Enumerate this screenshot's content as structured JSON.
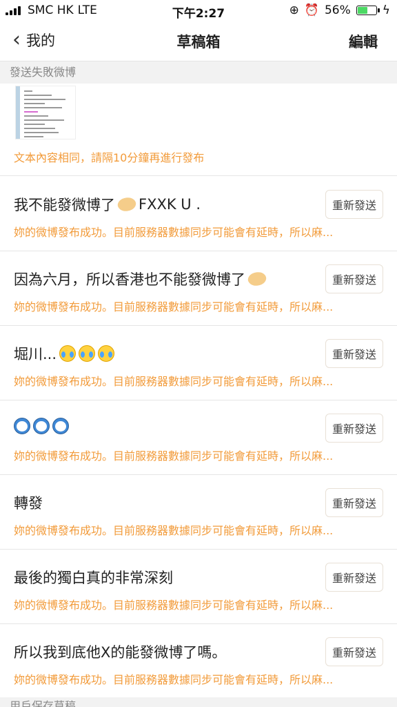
{
  "status_bar": {
    "carrier": "SMC HK",
    "network": "LTE",
    "time": "下午2:27",
    "battery": "56%",
    "battery_level": 0.56
  },
  "nav": {
    "back_label": "我的",
    "title": "草稿箱",
    "edit_label": "編輯"
  },
  "section_failed": "發送失敗微博",
  "first_item": {
    "error": "文本內容相同，請隔10分鐘再進行發布"
  },
  "resend_label": "重新發送",
  "items": [
    {
      "text": "我不能發微博了",
      "suffix": "FXXK U .",
      "emoji": "hands-icon",
      "status": "妳的微博發布成功。目前服務器數據同步可能會有延時，所以麻..."
    },
    {
      "text": "因為六月，所以香港也不能發微博了",
      "suffix": "",
      "emoji": "hands-icon",
      "status": "妳的微博發布成功。目前服務器數據同步可能會有延時，所以麻..."
    },
    {
      "text": "堀川...",
      "suffix": "",
      "emoji": "crying-face-icon",
      "status": "妳的微博發布成功。目前服務器數據同步可能會有延時，所以麻..."
    },
    {
      "text": "",
      "suffix": "",
      "emoji": "doraemon-icon",
      "status": "妳的微博發布成功。目前服務器數據同步可能會有延時，所以麻..."
    },
    {
      "text": "轉發",
      "suffix": "",
      "emoji": "",
      "status": "妳的微博發布成功。目前服務器數據同步可能會有延時，所以麻..."
    },
    {
      "text": "最後的獨白真的非常深刻",
      "suffix": "",
      "emoji": "",
      "status": "妳的微博發布成功。目前服務器數據同步可能會有延時，所以麻..."
    },
    {
      "text": "所以我到底他X的能發微博了嗎。",
      "suffix": "",
      "emoji": "",
      "status": "妳的微博發布成功。目前服務器數據同步可能會有延時，所以麻..."
    }
  ],
  "section_bottom": "用戶保存草稿",
  "colors": {
    "accent": "#f29b3a",
    "battery": "#4cd964"
  }
}
